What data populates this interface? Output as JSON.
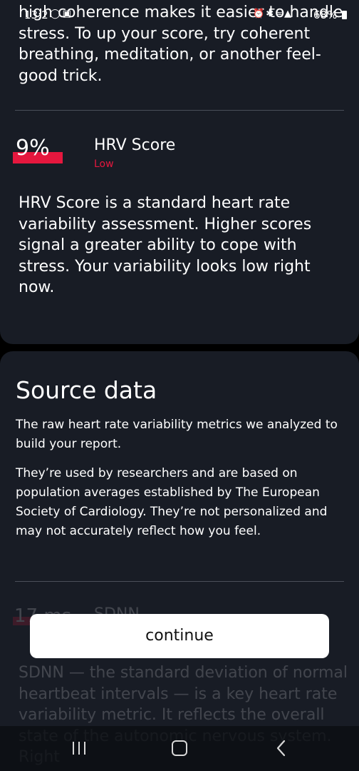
{
  "status_bar": {
    "time": "13:2",
    "battery": "68%",
    "icons_left": [
      "bike-icon",
      "gallery-icon"
    ],
    "icons_right": [
      "alarm-icon",
      "bluetooth-icon",
      "wifi-icon",
      "signal-icon"
    ]
  },
  "top_card": {
    "intro_text": "high coherence makes it easier to handle stress. To up your score, try coherent breathing, meditation, or another feel-good trick.",
    "hrv": {
      "value": "9%",
      "title": "HRV Score",
      "level": "Low",
      "level_color": "#e5173e",
      "description": "HRV Score is a standard heart rate variability assessment. Higher scores signal a greater ability to cope with stress. Your variability looks low right now."
    }
  },
  "source_data": {
    "title": "Source data",
    "paragraph_1": "The raw heart rate variability metrics we analyzed to build your report.",
    "paragraph_2": "They’re used by researchers and are based on population averages established by The European Society of Cardiology. They’re not personalized and may not accurately reflect how you feel.",
    "sdnn": {
      "value": "17 ms",
      "title": "SDNN",
      "description": "SDNN — the standard deviation of normal heartbeat intervals — is a key heart rate variability metric. It reflects the overall state of the autonomic nervous system. Right"
    }
  },
  "continue_label": "continue",
  "nav": {
    "recents": "recents-icon",
    "home": "home-icon",
    "back": "back-icon"
  },
  "colors": {
    "card_background": "#181c25",
    "accent_red": "#e5173e",
    "button_background": "#ffffff"
  }
}
